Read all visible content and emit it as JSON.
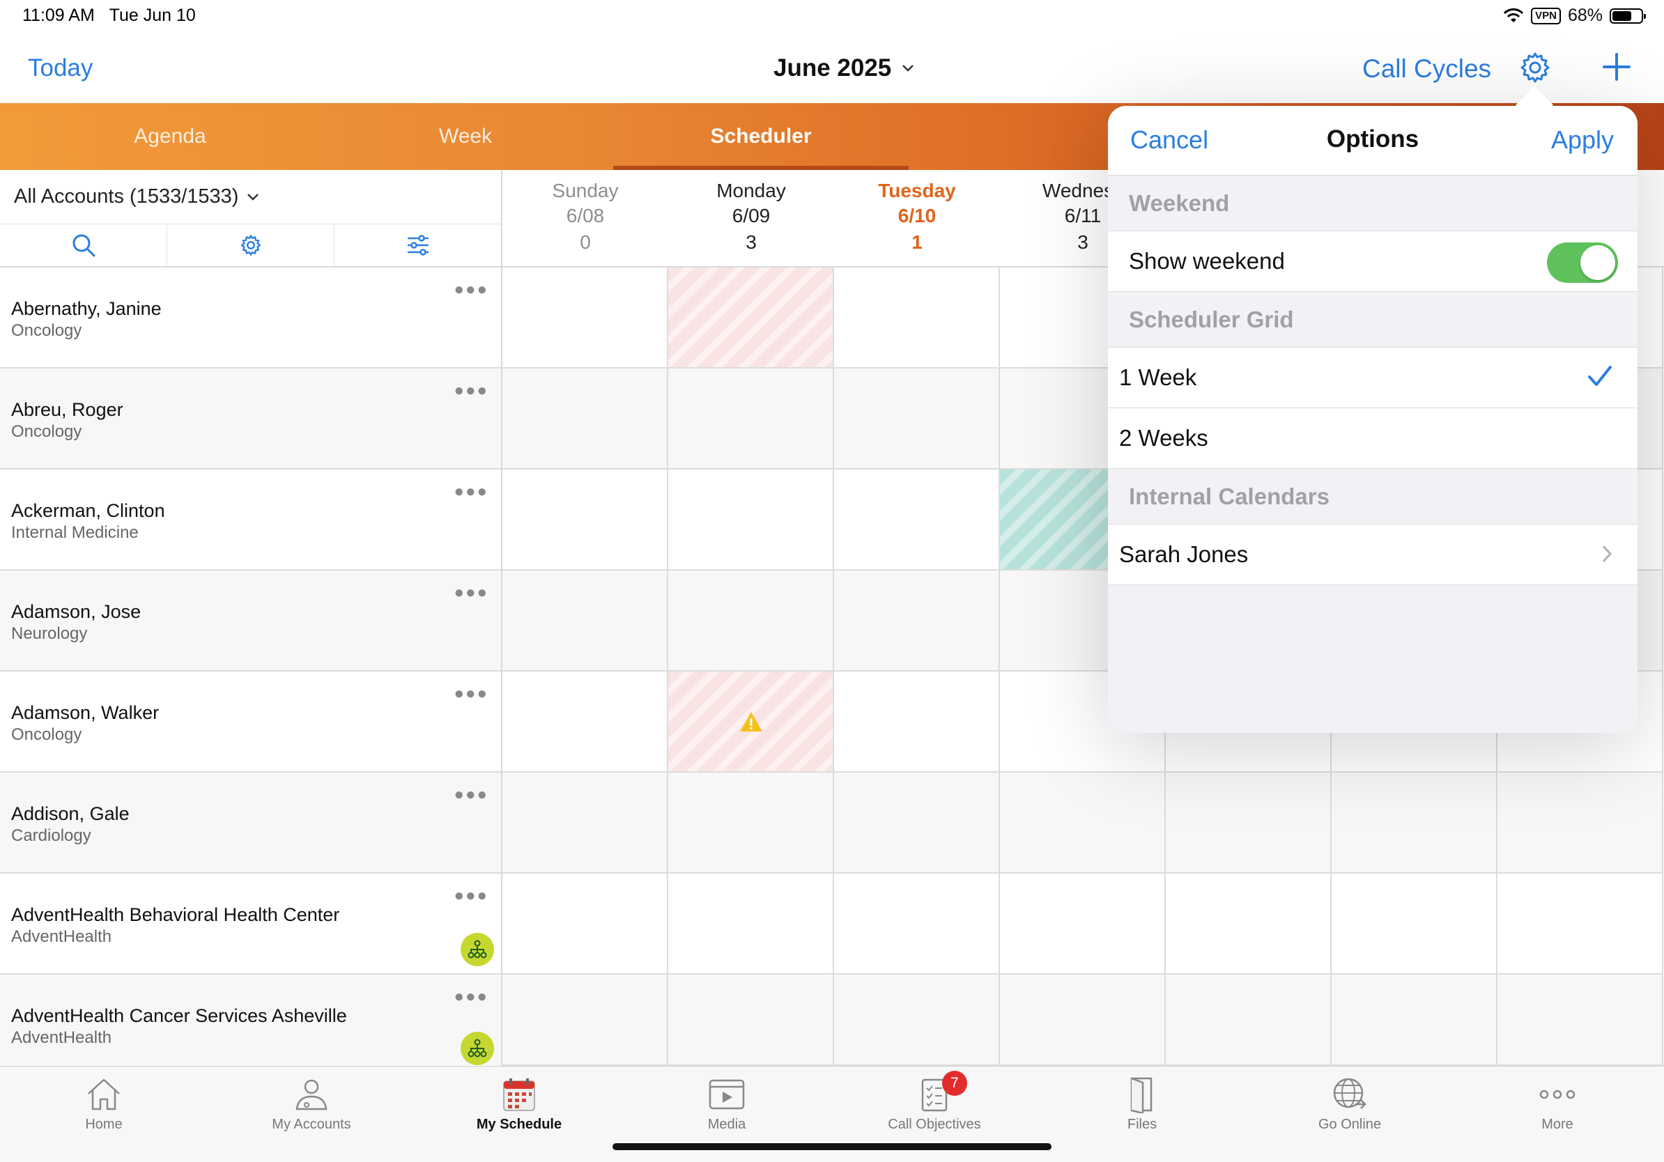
{
  "status": {
    "time": "11:09 AM",
    "date": "Tue Jun 10",
    "vpn": "VPN",
    "battery": "68%",
    "battery_level": 0.68
  },
  "nav": {
    "today": "Today",
    "title": "June 2025",
    "call_cycles": "Call Cycles"
  },
  "tabs": [
    {
      "label": "Agenda",
      "active": false
    },
    {
      "label": "Week",
      "active": false
    },
    {
      "label": "Scheduler",
      "active": true
    }
  ],
  "filter": {
    "label": "All Accounts (1533/1533)"
  },
  "days": [
    {
      "name": "Sunday",
      "date": "6/08",
      "count": "0"
    },
    {
      "name": "Monday",
      "date": "6/09",
      "count": "3"
    },
    {
      "name": "Tuesday",
      "date": "6/10",
      "count": "1"
    },
    {
      "name": "Wednesc",
      "date": "6/11",
      "count": "3"
    }
  ],
  "accounts": [
    {
      "name": "Abernathy, Janine",
      "specialty": "Oncology",
      "org_icon": false
    },
    {
      "name": "Abreu, Roger",
      "specialty": "Oncology",
      "org_icon": false
    },
    {
      "name": "Ackerman, Clinton",
      "specialty": "Internal Medicine",
      "org_icon": false
    },
    {
      "name": "Adamson, Jose",
      "specialty": "Neurology",
      "org_icon": false
    },
    {
      "name": "Adamson, Walker",
      "specialty": "Oncology",
      "org_icon": false
    },
    {
      "name": "Addison, Gale",
      "specialty": "Cardiology",
      "org_icon": false
    },
    {
      "name": "AdventHealth Behavioral Health Center",
      "specialty": "AdventHealth",
      "org_icon": true
    },
    {
      "name": "AdventHealth Cancer Services Asheville",
      "specialty": "AdventHealth",
      "org_icon": true
    }
  ],
  "options": {
    "cancel": "Cancel",
    "title": "Options",
    "apply": "Apply",
    "weekend_section": "Weekend",
    "show_weekend": "Show weekend",
    "show_weekend_on": true,
    "grid_section": "Scheduler Grid",
    "one_week": "1 Week",
    "two_weeks": "2 Weeks",
    "selected_grid": "1 Week",
    "calendars_section": "Internal Calendars",
    "calendar_user": "Sarah Jones"
  },
  "tabbar": [
    {
      "label": "Home",
      "icon": "home-icon"
    },
    {
      "label": "My Accounts",
      "icon": "accounts-icon"
    },
    {
      "label": "My Schedule",
      "icon": "calendar-icon",
      "active": true
    },
    {
      "label": "Media",
      "icon": "media-icon"
    },
    {
      "label": "Call Objectives",
      "icon": "checklist-icon",
      "badge": "7"
    },
    {
      "label": "Files",
      "icon": "files-icon"
    },
    {
      "label": "Go Online",
      "icon": "globe-icon"
    },
    {
      "label": "More",
      "icon": "more-icon"
    }
  ],
  "colors": {
    "accent": "#2a7de1",
    "today": "#e0641c",
    "toggle_on": "#5fc15b",
    "badge": "#e32b2b",
    "org_icon": "#c6d830"
  }
}
